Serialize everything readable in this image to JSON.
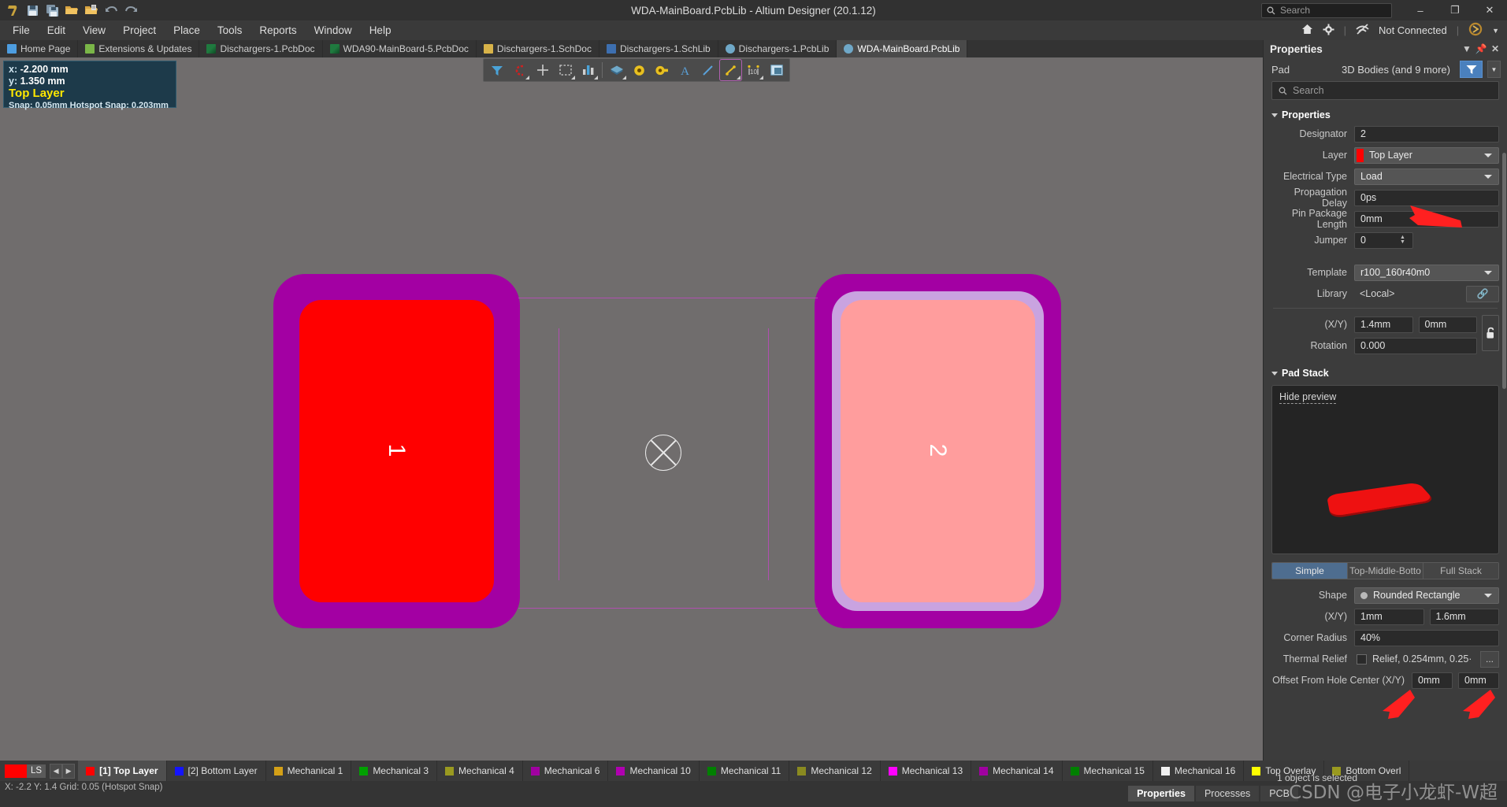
{
  "titlebar": {
    "title": "WDA-MainBoard.PcbLib - Altium Designer (20.1.12)",
    "search_placeholder": "Search",
    "minimize": "–",
    "restore": "❐",
    "close": "✕"
  },
  "menubar": {
    "items": [
      {
        "label": "File"
      },
      {
        "label": "Edit"
      },
      {
        "label": "View"
      },
      {
        "label": "Project"
      },
      {
        "label": "Place"
      },
      {
        "label": "Tools"
      },
      {
        "label": "Reports"
      },
      {
        "label": "Window"
      },
      {
        "label": "Help"
      }
    ],
    "right": {
      "home_icon": "home-icon",
      "gear_icon": "gear-icon",
      "connection": "Not Connected",
      "account_icon": "account-icon"
    }
  },
  "tabbar": {
    "tabs": [
      {
        "label": "Home Page",
        "icon": "home-icon",
        "kind": "home",
        "active": false
      },
      {
        "label": "Extensions & Updates",
        "icon": "extensions-icon",
        "kind": "ext",
        "active": false
      },
      {
        "label": "Dischargers-1.PcbDoc",
        "icon": "pcb-icon",
        "kind": "pcb",
        "active": false
      },
      {
        "label": "WDA90-MainBoard-5.PcbDoc",
        "icon": "pcb-icon",
        "kind": "pcb",
        "active": false
      },
      {
        "label": "Dischargers-1.SchDoc",
        "icon": "sch-icon",
        "kind": "sch",
        "active": false
      },
      {
        "label": "Dischargers-1.SchLib",
        "icon": "schlib-icon",
        "kind": "schlib",
        "active": false
      },
      {
        "label": "Dischargers-1.PcbLib",
        "icon": "pcblib-icon",
        "kind": "pcblib",
        "active": false
      },
      {
        "label": "WDA-MainBoard.PcbLib",
        "icon": "pcblib-icon",
        "kind": "pcblib",
        "active": true
      }
    ]
  },
  "canvas": {
    "info": {
      "x_label": "x:",
      "x_value": "-2.200 mm",
      "y_label": "y:",
      "y_value": "1.350 mm",
      "layer": "Top Layer",
      "snap": "Snap: 0.05mm Hotspot Snap: 0.203mm"
    },
    "toolbar_icons": [
      "filter-icon",
      "magnet-icon",
      "crosshair-icon",
      "select-area-icon",
      "measure-icon",
      "layers-icon",
      "via-icon",
      "pad-icon",
      "text-icon",
      "line-icon",
      "dimension-icon",
      "coordinate-icon",
      "polygon-icon"
    ],
    "pads": [
      {
        "designator": "1",
        "selected": true
      },
      {
        "designator": "2",
        "selected": false
      }
    ],
    "origin_marker": "origin-crosshair-icon"
  },
  "panel": {
    "title": "Properties",
    "header_icons": [
      "chevron-down-icon",
      "pin-icon",
      "close-icon"
    ],
    "object_type": "Pad",
    "object_scope": "3D Bodies (and 9 more)",
    "search_placeholder": "Search",
    "sections": {
      "properties": {
        "title": "Properties",
        "fields": [
          {
            "label": "Designator",
            "value": "2",
            "type": "input"
          },
          {
            "label": "Layer",
            "value": "Top Layer",
            "type": "select",
            "color": "#ff0000"
          },
          {
            "label": "Electrical Type",
            "value": "Load",
            "type": "select"
          },
          {
            "label": "Propagation Delay",
            "value": "0ps",
            "type": "input"
          },
          {
            "label": "Pin Package Length",
            "value": "0mm",
            "type": "input"
          },
          {
            "label": "Jumper",
            "value": "0",
            "type": "spin"
          },
          {
            "label": "Template",
            "value": "r100_160r40m0",
            "type": "select"
          },
          {
            "label": "Library",
            "value": "<Local>",
            "type": "static"
          }
        ],
        "position": {
          "label": "(X/Y)",
          "x": "1.4mm",
          "y": "0mm",
          "rotation_label": "Rotation",
          "rotation": "0.000",
          "lock_icon": "unlock-icon"
        }
      },
      "padstack": {
        "title": "Pad Stack",
        "hide_preview": "Hide preview",
        "modes": [
          {
            "label": "Simple",
            "active": true
          },
          {
            "label": "Top-Middle-Botto",
            "active": false
          },
          {
            "label": "Full Stack",
            "active": false
          }
        ],
        "fields": [
          {
            "label": "Shape",
            "value": "Rounded Rectangle",
            "type": "select-dot"
          },
          {
            "label": "(X/Y)",
            "x": "1mm",
            "y": "1.6mm",
            "type": "xy"
          },
          {
            "label": "Corner Radius",
            "value": "40%",
            "type": "input"
          },
          {
            "label": "Thermal Relief",
            "value": "Relief, 0.254mm, 0.25·",
            "type": "check",
            "more": "..."
          },
          {
            "label": "Offset From Hole Center (X/Y)",
            "x": "0mm",
            "y": "0mm",
            "type": "xy-wide"
          }
        ]
      }
    },
    "footer": "1 object is selected"
  },
  "layerbar": {
    "swatch_color": "#ff0000",
    "ls_label": "LS",
    "prev_icon": "chevron-left-icon",
    "next_icon": "chevron-right-icon",
    "layers": [
      {
        "label": "[1] Top Layer",
        "color": "#ff0000",
        "active": true
      },
      {
        "label": "[2] Bottom Layer",
        "color": "#1414ff",
        "active": false
      },
      {
        "label": "Mechanical 1",
        "color": "#d4a017",
        "active": false
      },
      {
        "label": "Mechanical 3",
        "color": "#00a000",
        "active": false
      },
      {
        "label": "Mechanical 4",
        "color": "#9a9a20",
        "active": false
      },
      {
        "label": "Mechanical 6",
        "color": "#a000a0",
        "active": false
      },
      {
        "label": "Mechanical 10",
        "color": "#b000b0",
        "active": false
      },
      {
        "label": "Mechanical 11",
        "color": "#008000",
        "active": false
      },
      {
        "label": "Mechanical 12",
        "color": "#8a8a20",
        "active": false
      },
      {
        "label": "Mechanical 13",
        "color": "#ff00ff",
        "active": false
      },
      {
        "label": "Mechanical 14",
        "color": "#a000a0",
        "active": false
      },
      {
        "label": "Mechanical 15",
        "color": "#008000",
        "active": false
      },
      {
        "label": "Mechanical 16",
        "color": "#f0f0f0",
        "active": false
      },
      {
        "label": "Top Overlay",
        "color": "#ffff00",
        "active": false
      },
      {
        "label": "Bottom Overl",
        "color": "#9a9a20",
        "active": false
      }
    ]
  },
  "statusbar": {
    "coords": "X: -2.2   Y: 1.4      Grid: 0.05      (Hotspot Snap)",
    "object_selected": "1 object is selected",
    "tabs": [
      {
        "label": "Properties",
        "active": true
      },
      {
        "label": "Processes",
        "active": false
      },
      {
        "label": "PCB",
        "active": false
      }
    ],
    "watermark": "CSDN @电子小龙虾-W超"
  }
}
